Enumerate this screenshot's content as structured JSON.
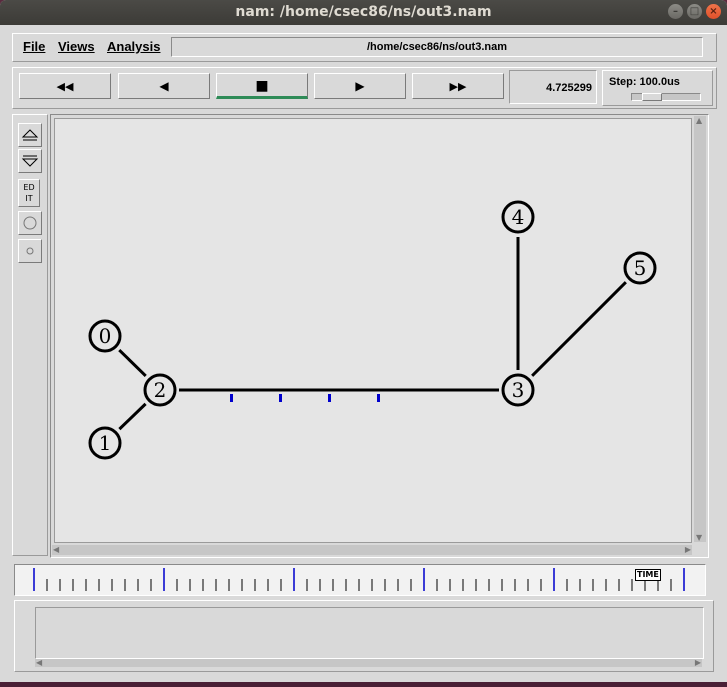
{
  "window": {
    "title": "nam: /home/csec86/ns/out3.nam"
  },
  "menu": {
    "file": "File",
    "views": "Views",
    "analysis": "Analysis",
    "file_path": "/home/csec86/ns/out3.nam"
  },
  "playback": {
    "rewind": "◀◀",
    "back": "◀",
    "stop": "■",
    "play": "▶",
    "fast_forward": "▶▶",
    "active": "stop",
    "current_time": "4.725299",
    "step_label": "Step: 100.0us"
  },
  "tools": {
    "edit": "ED IT"
  },
  "topology": {
    "nodes": [
      {
        "id": "0",
        "label": "0"
      },
      {
        "id": "1",
        "label": "1"
      },
      {
        "id": "2",
        "label": "2"
      },
      {
        "id": "3",
        "label": "3"
      },
      {
        "id": "4",
        "label": "4"
      },
      {
        "id": "5",
        "label": "5"
      }
    ],
    "links": [
      [
        "0",
        "2"
      ],
      [
        "1",
        "2"
      ],
      [
        "2",
        "3"
      ],
      [
        "3",
        "4"
      ],
      [
        "3",
        "5"
      ]
    ],
    "packets_on_link": [
      "2",
      "3"
    ],
    "packet_count": 4,
    "packet_color": "#0000cc"
  },
  "timeline": {
    "marker_label": "TIME"
  },
  "colors": {
    "window_bg": "#d9d9d9",
    "canvas_bg": "#e5e5e5",
    "active_indicator": "#2e8b57"
  }
}
